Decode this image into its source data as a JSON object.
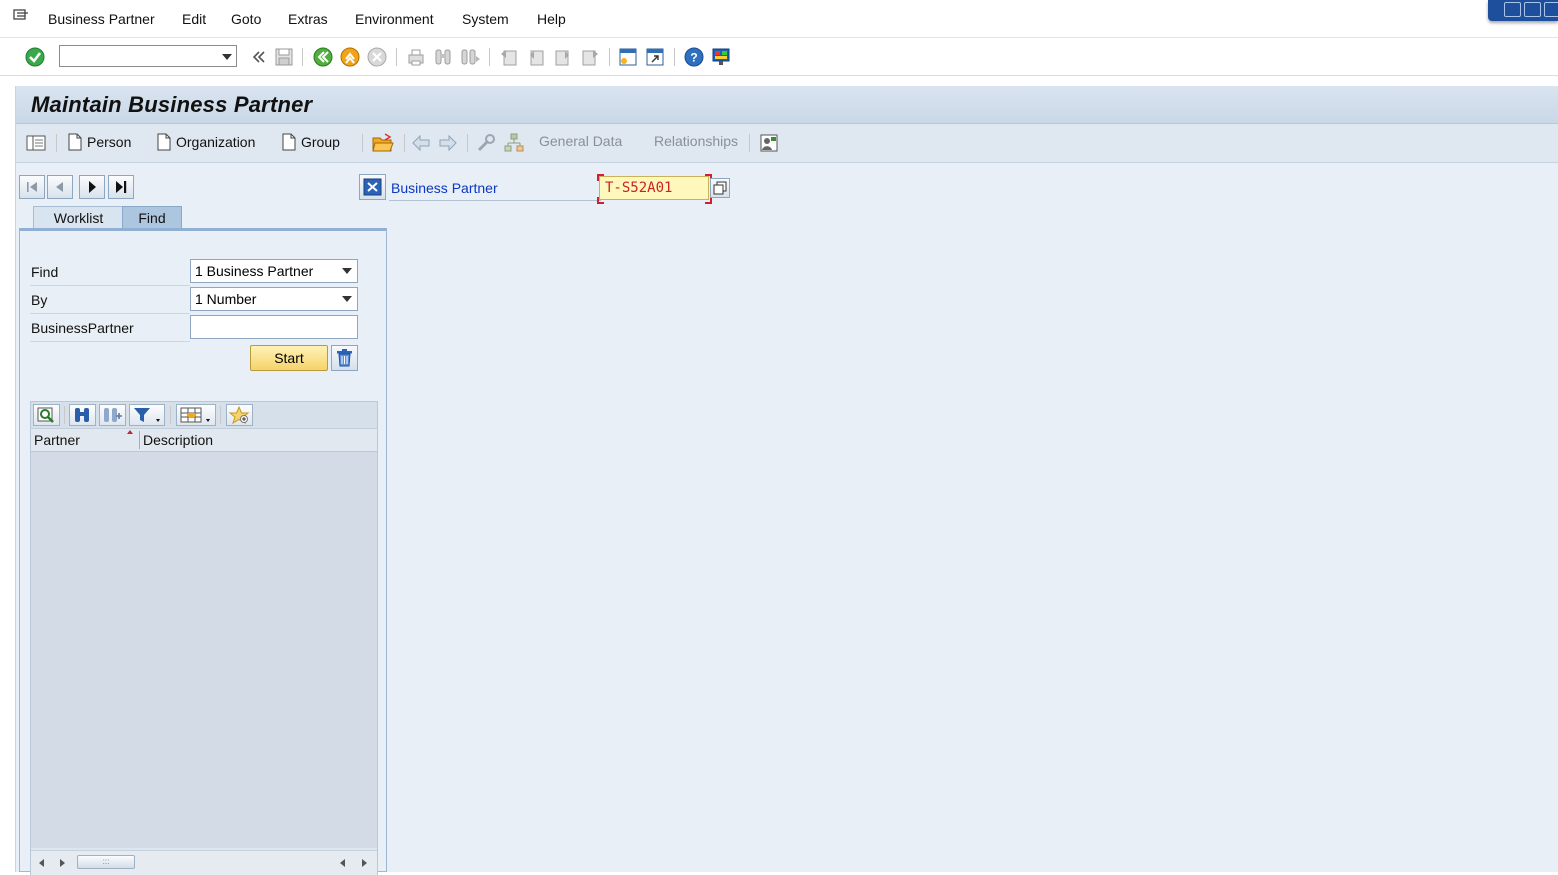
{
  "menubar": {
    "items": [
      "Business Partner",
      "Edit",
      "Goto",
      "Extras",
      "Environment",
      "System",
      "Help"
    ]
  },
  "systoolbar": {
    "command_value": "",
    "icons": [
      "enter-icon",
      "back-icon",
      "save-icon",
      "back-nav-icon",
      "exit-icon",
      "cancel-icon",
      "print-icon",
      "find-icon",
      "find-next-icon",
      "first-page-icon",
      "prev-page-icon",
      "next-page-icon",
      "last-page-icon",
      "new-session-icon",
      "shortcut-icon",
      "help-icon",
      "layout-icon"
    ]
  },
  "title": "Maintain Business Partner",
  "apptoolbar": {
    "person": "Person",
    "organization": "Organization",
    "group": "Group",
    "general_data": "General Data",
    "relationships": "Relationships"
  },
  "tabs": {
    "worklist": "Worklist",
    "find": "Find"
  },
  "find_panel": {
    "find_label": "Find",
    "find_value": "1 Business Partner",
    "by_label": "By",
    "by_value": "1 Number",
    "bp_label": "BusinessPartner",
    "bp_value": "",
    "start": "Start"
  },
  "grid": {
    "columns": [
      "Partner",
      "Description"
    ],
    "rows": []
  },
  "bp_field": {
    "label": "Business Partner",
    "value": "T-S52A01"
  },
  "colors": {
    "main_bg": "#e9eff6",
    "title_bg": "#d3e0ec",
    "link_blue": "#0b37c2",
    "input_yellow": "#fff8bd",
    "start_button": "#f5d36a"
  }
}
